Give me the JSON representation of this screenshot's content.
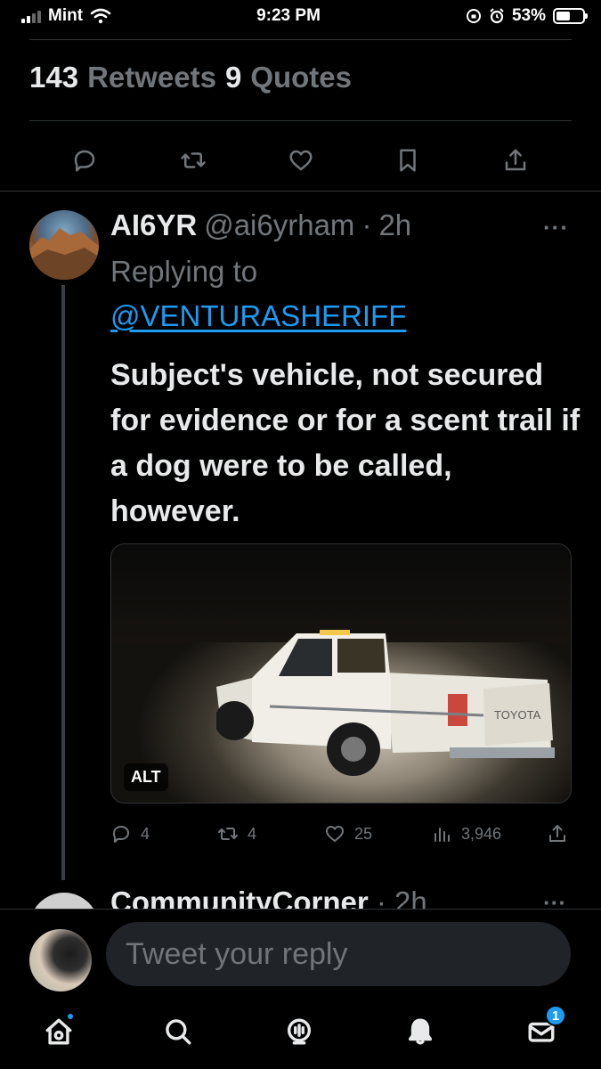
{
  "status_bar": {
    "carrier": "Mint",
    "time": "9:23 PM",
    "battery": "53%",
    "battery_level": 0.53
  },
  "engagement": {
    "retweets_count": "143",
    "retweets_label": "Retweets",
    "quotes_count": "9",
    "quotes_label": "Quotes"
  },
  "action_bar": {
    "icons": [
      "reply-icon",
      "retweet-icon",
      "like-icon",
      "bookmark-icon",
      "share-icon"
    ]
  },
  "reply_tweet": {
    "name": "AI6YR",
    "handle": "@ai6yrham",
    "separator": "·",
    "time": "2h",
    "more": "···",
    "replying_to_label": "Replying to",
    "replying_to_handle": "@VENTURASHERIFF",
    "text": "Subject's vehicle, not secured for evidence or for a scent trail if a dog were to be called, however.",
    "media": {
      "alt_badge": "ALT",
      "vehicle_label": "TOYOTA"
    },
    "metrics": {
      "replies": "4",
      "retweets": "4",
      "likes": "25",
      "views": "3,946"
    }
  },
  "next_tweet": {
    "name": "CommunityCorner",
    "separator": "·",
    "time": "2h",
    "more": "···"
  },
  "reply_composer": {
    "placeholder": "Tweet your reply"
  },
  "tab_bar": {
    "messages_badge": "1",
    "accent": "#1d9bf0"
  }
}
